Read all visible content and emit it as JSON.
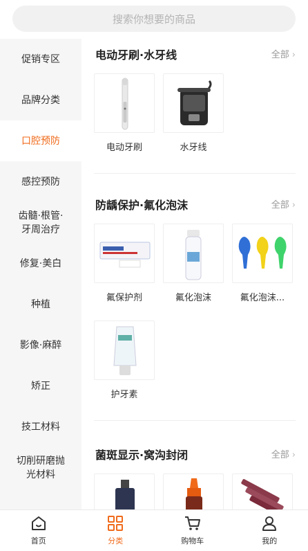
{
  "search": {
    "placeholder": "搜索你想要的商品"
  },
  "sidebar": {
    "items": [
      {
        "label": "促销专区",
        "active": false
      },
      {
        "label": "品牌分类",
        "active": false
      },
      {
        "label": "口腔预防",
        "active": true
      },
      {
        "label": "感控预防",
        "active": false
      },
      {
        "label": "齿髓·根管·\n牙周治疗",
        "active": false
      },
      {
        "label": "修复·美白",
        "active": false
      },
      {
        "label": "种植",
        "active": false
      },
      {
        "label": "影像·麻醉",
        "active": false
      },
      {
        "label": "矫正",
        "active": false
      },
      {
        "label": "技工材料",
        "active": false
      },
      {
        "label": "切削研磨抛\n光材料",
        "active": false
      }
    ]
  },
  "sections": [
    {
      "title": "电动牙刷·水牙线",
      "all_label": "全部",
      "products": [
        {
          "name": "电动牙刷",
          "icon": "electric-toothbrush"
        },
        {
          "name": "水牙线",
          "icon": "water-flosser"
        }
      ]
    },
    {
      "title": "防龋保护·氟化泡沫",
      "all_label": "全部",
      "products": [
        {
          "name": "氟保护剂",
          "icon": "fluoride-varnish"
        },
        {
          "name": "氟化泡沫",
          "icon": "fluoride-foam"
        },
        {
          "name": "氟化泡沫...",
          "icon": "fluoride-trays"
        },
        {
          "name": "护牙素",
          "icon": "tooth-mousse"
        }
      ]
    },
    {
      "title": "菌斑显示·窝沟封闭",
      "all_label": "全部",
      "products": [
        {
          "name": "",
          "icon": "plaque-disclosing-bottle"
        },
        {
          "name": "",
          "icon": "orange-bottle"
        },
        {
          "name": "",
          "icon": "sealant-syringes"
        }
      ]
    }
  ],
  "tabbar": {
    "items": [
      {
        "label": "首页",
        "icon": "home-icon",
        "active": false
      },
      {
        "label": "分类",
        "icon": "category-icon",
        "active": true
      },
      {
        "label": "购物车",
        "icon": "cart-icon",
        "active": false
      },
      {
        "label": "我的",
        "icon": "user-icon",
        "active": false
      }
    ]
  },
  "colors": {
    "accent": "#f06a1a",
    "sidebar_bg": "#f6f6f6",
    "search_bg": "#f1f1f1"
  }
}
